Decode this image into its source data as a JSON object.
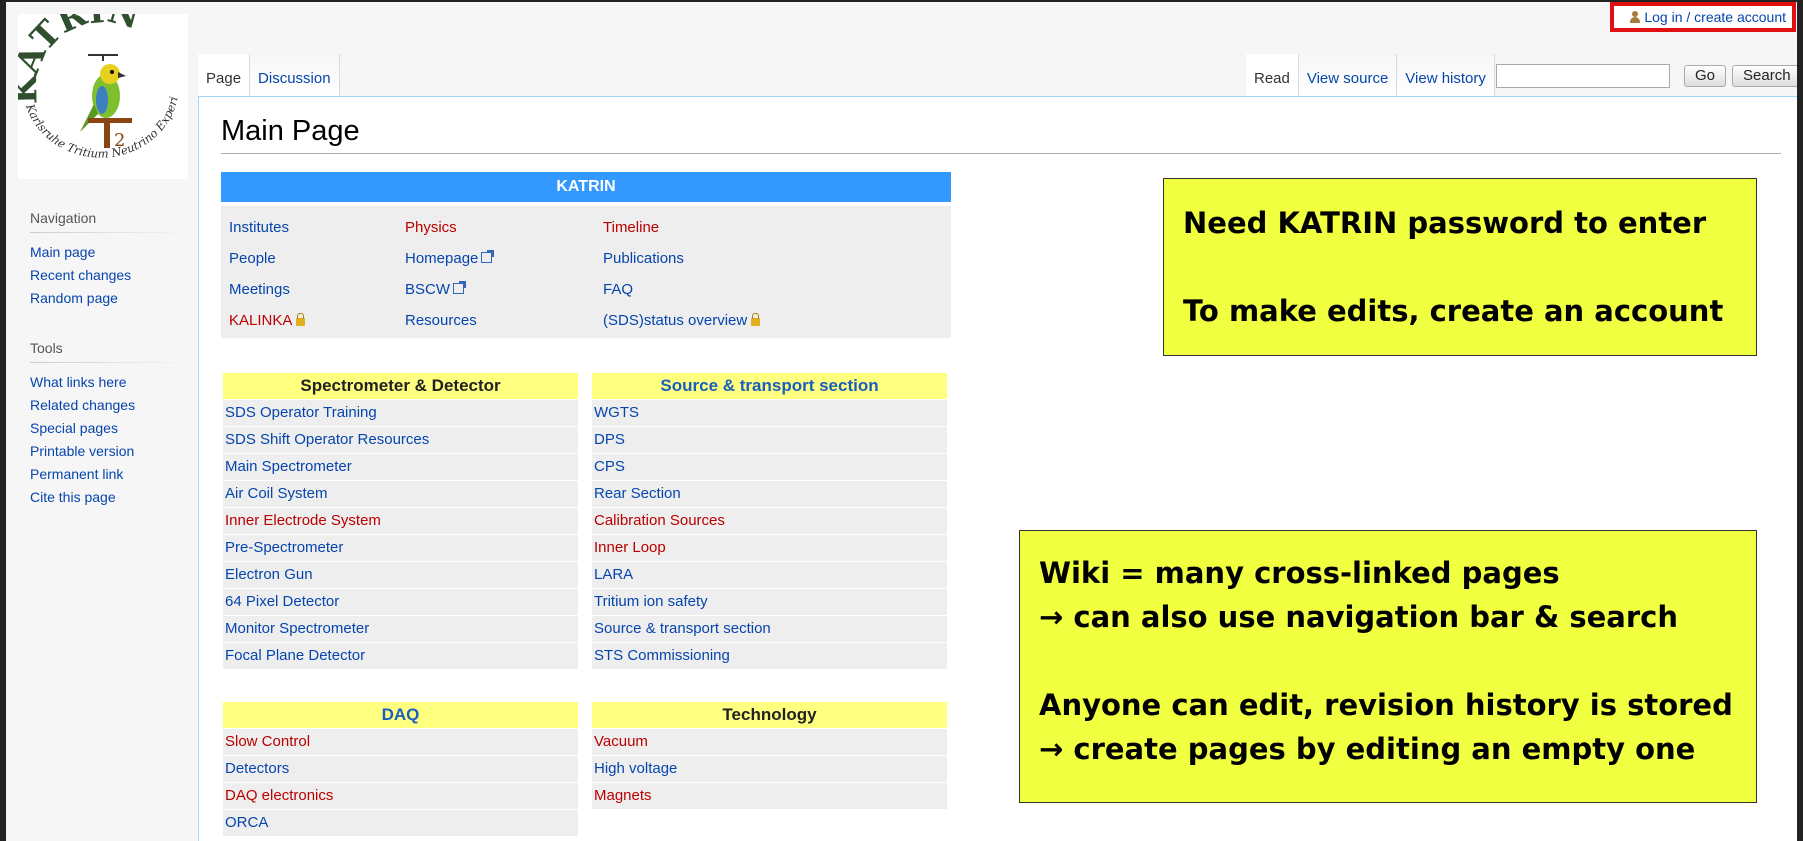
{
  "login": {
    "label": "Log in / create account"
  },
  "logo": {
    "top_text": "KATRIN",
    "ring_text": "Karlsruhe Tritium Neutrino Experiment",
    "subscript": "2"
  },
  "tabs": {
    "left": [
      "Page",
      "Discussion"
    ],
    "right": [
      "Read",
      "View source",
      "View history"
    ]
  },
  "search": {
    "placeholder": "",
    "go_label": "Go",
    "search_label": "Search"
  },
  "sidebar": {
    "navigation": {
      "title": "Navigation",
      "items": [
        "Main page",
        "Recent changes",
        "Random page"
      ]
    },
    "tools": {
      "title": "Tools",
      "items": [
        "What links here",
        "Related changes",
        "Special pages",
        "Printable version",
        "Permanent link",
        "Cite this page"
      ]
    }
  },
  "main": {
    "title": "Main Page",
    "katrin": {
      "header": "KATRIN",
      "rows": [
        [
          "Institutes",
          "Physics",
          "Timeline"
        ],
        [
          "People",
          "Homepage",
          "Publications"
        ],
        [
          "Meetings",
          "BSCW",
          "FAQ"
        ],
        [
          "KALINKA",
          "Resources",
          "(SDS)status overview"
        ]
      ]
    },
    "spectrometer": {
      "header": "Spectrometer & Detector",
      "items": [
        "SDS Operator Training",
        "SDS Shift Operator Resources",
        "Main Spectrometer",
        "Air Coil System",
        "Inner Electrode System",
        "Pre-Spectrometer",
        "Electron Gun",
        "64 Pixel Detector",
        "Monitor Spectrometer",
        "Focal Plane Detector"
      ]
    },
    "source": {
      "header": "Source & transport section",
      "items": [
        "WGTS",
        "DPS",
        "CPS",
        "Rear Section",
        "Calibration Sources",
        "Inner Loop",
        "LARA",
        "Tritium ion safety",
        "Source & transport section",
        "STS Commissioning"
      ]
    },
    "daq": {
      "header": "DAQ",
      "items": [
        "Slow Control",
        "Detectors",
        "DAQ electronics",
        "ORCA"
      ]
    },
    "technology": {
      "header": "Technology",
      "items": [
        "Vacuum",
        "High voltage",
        "Magnets"
      ]
    }
  },
  "notes": {
    "note1": [
      "Need KATRIN password to enter",
      "To make edits, create an account"
    ],
    "note2": [
      "Wiki = many cross-linked pages",
      "→ can also use navigation bar & search",
      "Anyone can edit, revision history is stored",
      "→ create pages by editing an empty one"
    ]
  },
  "colors": {
    "link": "#0645ad",
    "redlink": "#ba0000",
    "katrin_header": "#3399ff",
    "section_header": "#ffff80",
    "note_bg": "#f0ff40",
    "login_border": "#e01010"
  }
}
